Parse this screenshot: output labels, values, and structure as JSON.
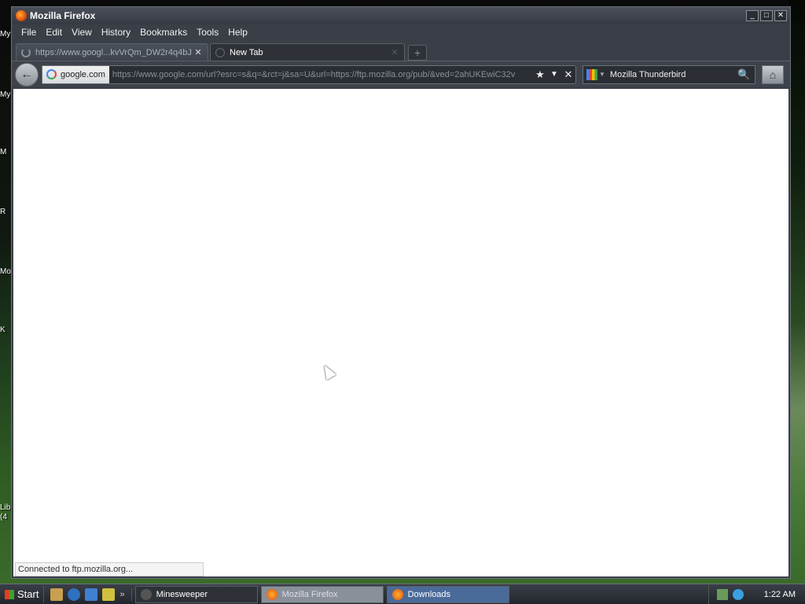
{
  "desktop": {
    "icon_labels": [
      "My",
      "My",
      "M",
      "R",
      "Mo",
      "K",
      "Lib (4"
    ]
  },
  "window": {
    "title": "Mozilla Firefox",
    "controls": {
      "minimize": "_",
      "maximize": "□",
      "close": "✕"
    }
  },
  "menubar": {
    "items": [
      "File",
      "Edit",
      "View",
      "History",
      "Bookmarks",
      "Tools",
      "Help"
    ]
  },
  "tabs": [
    {
      "title": "https://www.googl...kvVrQm_DW2r4q4bJ",
      "close": "✕"
    },
    {
      "title": "New Tab",
      "close": "✕"
    }
  ],
  "newtab_label": "+",
  "navbar": {
    "back_glyph": "←",
    "site_identity": "google.com",
    "url": "https://www.google.com/url?esrc=s&q=&rct=j&sa=U&url=https://ftp.mozilla.org/pub/&ved=2ahUKEwiC32v",
    "bookmark_glyph": "★",
    "dropdown_glyph": "▼",
    "stop_glyph": "✕",
    "search_engine_drop": "▼",
    "search_text": "Mozilla Thunderbird",
    "search_go_glyph": "🔍",
    "home_glyph": "⌂"
  },
  "statusbar": {
    "text": "Connected to ftp.mozilla.org..."
  },
  "taskbar": {
    "start_label": "Start",
    "quicklaunch_more": "»",
    "tasks": [
      "Minesweeper",
      "Mozilla Firefox",
      "Downloads"
    ],
    "clock": "1:22 AM"
  },
  "colors": {
    "chrome_dark": "#3a3f47",
    "content_bg": "#ffffff",
    "firefox_orange": "#e05010"
  }
}
